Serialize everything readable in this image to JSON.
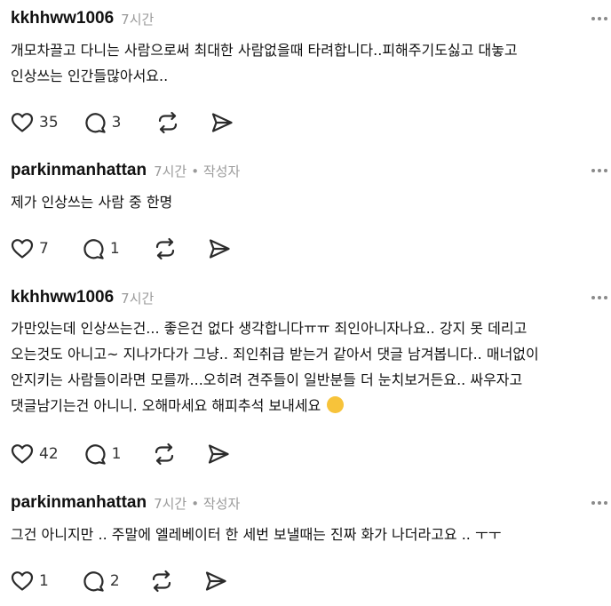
{
  "comments": [
    {
      "username": "kkhhww1006",
      "time": "7시간",
      "author_tag": "",
      "lines": [
        "개모차끌고 다니는 사람으로써 최대한 사람없을때 타려합니다..피해주기도싫고 대놓고",
        "인상쓰는 인간들많아서요.."
      ],
      "likes": "35",
      "replies": "3"
    },
    {
      "username": "parkinmanhattan",
      "time": "7시간",
      "author_tag": "• 작성자",
      "lines": [
        "제가 인상쓰는 사람 중 한명"
      ],
      "likes": "7",
      "replies": "1"
    },
    {
      "username": "kkhhww1006",
      "time": "7시간",
      "author_tag": "",
      "lines": [
        "가만있는데 인상쓰는건... 좋은건 없다 생각합니다ㅠㅠ 죄인아니자나요.. 강지 못 데리고",
        "오는것도 아니고~ 지나가다가 그냥.. 죄인취급 받는거 같아서 댓글 남겨봅니다.. 매너없이",
        "안지키는 사람들이라면 모를까...오히려 견주들이 일반분들 더 눈치보거든요.. 싸우자고",
        "댓글남기는건 아니니. 오해마세요 해피추석 보내세요"
      ],
      "emoji": "hugging-face-emoji",
      "likes": "42",
      "replies": "1"
    },
    {
      "username": "parkinmanhattan",
      "time": "7시간",
      "author_tag": "• 작성자",
      "lines": [
        "그건 아니지만 .. 주말에 엘레베이터 한 세번 보낼때는 진짜 화가 나더라고요 .. ㅜㅜ"
      ],
      "likes": "1",
      "replies": "2"
    }
  ],
  "icons": {
    "like": "heart-icon",
    "reply": "comment-bubble-icon",
    "repost": "repost-icon",
    "share": "send-icon",
    "more": "more-options-icon"
  },
  "colors": {
    "text": "#111111",
    "meta": "#9a9a9a",
    "icon": "#2b2b2b",
    "background": "#ffffff"
  }
}
